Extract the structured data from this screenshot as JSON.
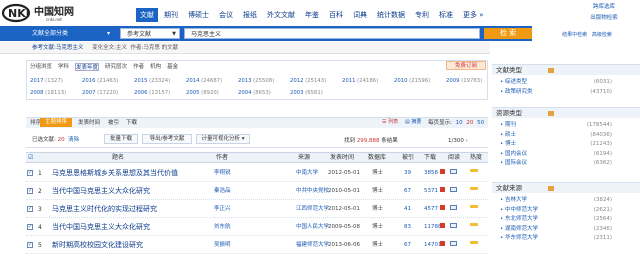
{
  "header": {
    "logo_cn": "中国知网",
    "logo_en": "cnki.net",
    "nav": [
      "文献",
      "期刊",
      "博硕士",
      "会议",
      "报纸",
      "外文文献",
      "年鉴",
      "百科",
      "词典",
      "统计数据",
      "专利",
      "标准",
      "更多"
    ],
    "nav_active": 0,
    "toplinks": [
      "跨库选库",
      "出版物检索"
    ]
  },
  "search": {
    "category": "文献全部分类",
    "field": "参考文献",
    "query": "马克思主义",
    "button": "检 索",
    "links": [
      "结果中检索",
      "高级检索"
    ]
  },
  "breadcrumb": {
    "left": "参考文献:马克思主义",
    "sub": "变化全文:主义",
    "author": "作者:马克思 的文献"
  },
  "grouping": {
    "tabs": [
      "分组浏览",
      "学科",
      "发表年度",
      "研究层次",
      "作者",
      "机构",
      "基金"
    ],
    "selected": 2,
    "free_order": "免费订阅",
    "years_row1": [
      [
        "2017",
        "1327"
      ],
      [
        "2016",
        "21463"
      ],
      [
        "2015",
        "23324"
      ],
      [
        "2014",
        "24687"
      ],
      [
        "2013",
        "25508"
      ],
      [
        "2012",
        "25143"
      ],
      [
        "2011",
        "24186"
      ],
      [
        "2010",
        "21596"
      ],
      [
        "2009",
        "19783"
      ]
    ],
    "years_row2": [
      [
        "2008",
        "18113"
      ],
      [
        "2007",
        "17220"
      ],
      [
        "2006",
        "13157"
      ],
      [
        "2005",
        "8920"
      ],
      [
        "2004",
        "8653"
      ],
      [
        "2003",
        "6561"
      ]
    ]
  },
  "sidebar": {
    "sections": [
      {
        "title": "文献类型",
        "items": [
          [
            "综述类型",
            "6031"
          ],
          [
            "政策研究类",
            "43710"
          ]
        ]
      },
      {
        "title": "资源类型",
        "items": [
          [
            "期刊",
            "178544"
          ],
          [
            "硕士",
            "84036"
          ],
          [
            "博士",
            "21243"
          ],
          [
            "国内会议",
            "6194"
          ],
          [
            "国际会议",
            "6362"
          ]
        ]
      },
      {
        "title": "文献来源",
        "items": [
          [
            "吉林大学",
            "3824"
          ],
          [
            "中中师范大学",
            "2621"
          ],
          [
            "东北师范大学",
            "2564"
          ],
          [
            "湖南师范大学",
            "2346"
          ],
          [
            "华东师范大学",
            "2311"
          ]
        ]
      }
    ]
  },
  "toolbar": {
    "sort_label": "排序:",
    "sort_selected": "主题排序",
    "sort_options": [
      "发表时间",
      "被引",
      "下载"
    ],
    "view_list": "列表",
    "view_summary": "摘要",
    "perpage_label": "每页显示:",
    "perpage_options": [
      "10",
      "20",
      "50"
    ],
    "perpage_selected": 1,
    "selected_label": "已选文献:",
    "selected_count": "20",
    "clear": "清除",
    "btn_batch": "批量下载",
    "btn_export": "导出/参考文献",
    "btn_viz": "计量可视化分析",
    "found_prefix": "找到",
    "found_count": "299,888",
    "found_suffix": "条结果",
    "pager": "1/300"
  },
  "table": {
    "headers": [
      "题名",
      "作者",
      "来源",
      "发表时间",
      "数据库",
      "被引",
      "下载",
      "阅读",
      "热度"
    ],
    "rows": [
      {
        "no": "1",
        "title": "马克思恩格斯城乡关系思想及其当代价值",
        "author": "李翔锐",
        "source": "中南大学",
        "date": "2012-05-01",
        "db": "博士",
        "cite": "39",
        "down": "3858"
      },
      {
        "no": "2",
        "title": "当代中国马克思主义大众化研究",
        "author": "秦浩品",
        "source": "中共中央党校",
        "date": "2010-05-01",
        "db": "博士",
        "cite": "67",
        "down": "5371"
      },
      {
        "no": "3",
        "title": "马克思主义时代化的实现过程研究",
        "author": "李正兴",
        "source": "江西师范大学",
        "date": "2012-05-01",
        "db": "博士",
        "cite": "41",
        "down": "4577"
      },
      {
        "no": "4",
        "title": "当代中国马克思主义大众化研究",
        "author": "刘东航",
        "source": "中国人民大学",
        "date": "2009-05-08",
        "db": "博士",
        "cite": "83",
        "down": "11788"
      },
      {
        "no": "5",
        "title": "新时期高校校园文化建设研究",
        "author": "吴振明",
        "source": "福建师范大学",
        "date": "2013-06-06",
        "db": "博士",
        "cite": "67",
        "down": "14701"
      }
    ]
  }
}
